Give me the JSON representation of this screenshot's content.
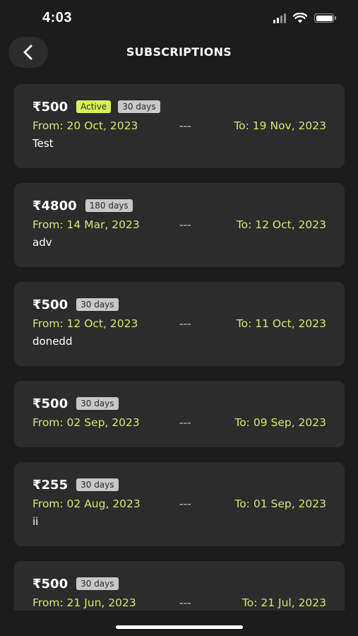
{
  "status_bar": {
    "time": "4:03",
    "icons": [
      "signal-icon",
      "wifi-icon",
      "battery-icon"
    ]
  },
  "header": {
    "title": "SUBSCRIPTIONS",
    "back_icon": "chevron-left-icon"
  },
  "colors": {
    "background": "#1c1c1c",
    "card": "#2c2c2c",
    "accent": "#d4e96b",
    "active_badge": "#d6f25d",
    "days_badge": "#c8c8c8"
  },
  "subscriptions": [
    {
      "amount": "₹500",
      "status": "Active",
      "duration": "30 days",
      "from": "From: 20 Oct, 2023",
      "separator": "---",
      "to": "To: 19 Nov, 2023",
      "note": "Test"
    },
    {
      "amount": "₹4800",
      "duration": "180 days",
      "from": "From: 14 Mar, 2023",
      "separator": "---",
      "to": "To: 12 Oct, 2023",
      "note": "adv"
    },
    {
      "amount": "₹500",
      "duration": "30 days",
      "from": "From: 12 Oct, 2023",
      "separator": "---",
      "to": "To: 11 Oct, 2023",
      "note": "donedd"
    },
    {
      "amount": "₹500",
      "duration": "30 days",
      "from": "From: 02 Sep, 2023",
      "separator": "---",
      "to": "To: 09 Sep, 2023"
    },
    {
      "amount": "₹255",
      "duration": "30 days",
      "from": "From: 02 Aug, 2023",
      "separator": "---",
      "to": "To: 01 Sep, 2023",
      "note": "ii"
    },
    {
      "amount": "₹500",
      "duration": "30 days",
      "from": "From: 21 Jun, 2023",
      "separator": "---",
      "to": "To: 21 Jul, 2023"
    }
  ]
}
